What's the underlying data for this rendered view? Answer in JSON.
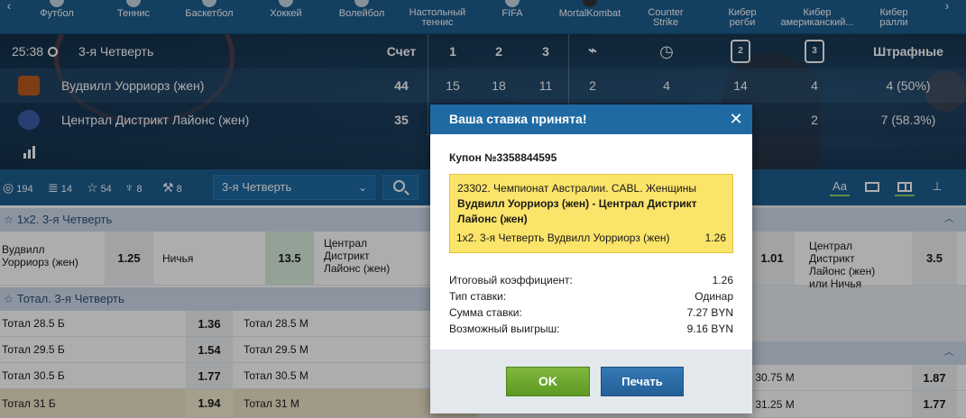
{
  "sports": [
    {
      "label": "Футбол",
      "icon": "football-icon"
    },
    {
      "label": "Теннис",
      "icon": "tennis-icon"
    },
    {
      "label": "Баскетбол",
      "icon": "basketball-icon"
    },
    {
      "label": "Хоккей",
      "icon": "hockey-icon"
    },
    {
      "label": "Волейбол",
      "icon": "volleyball-icon"
    },
    {
      "label": "Настольный",
      "label2": "теннис",
      "icon": "table-tennis-icon"
    },
    {
      "label": "FIFA",
      "icon": "fifa-icon"
    },
    {
      "label": "MortalKombat",
      "icon": "mortal-kombat-icon"
    },
    {
      "label": "Counter",
      "label2": "Strike",
      "icon": "counter-strike-icon"
    },
    {
      "label": "Кибер",
      "label2": "регби",
      "icon": "cyber-rugby-icon"
    },
    {
      "label": "Кибер",
      "label2": "американский...",
      "icon": "cyber-american-football-icon"
    },
    {
      "label": "Кибер",
      "label2": "ралли",
      "icon": "cyber-rally-icon"
    }
  ],
  "scoreboard": {
    "time": "25:38",
    "period": "3-я Четверть",
    "headers": {
      "score": "Счет",
      "q1": "1",
      "q2": "2",
      "q3": "3",
      "fouls": "Штрафные",
      "h2": "2",
      "h3": "3"
    },
    "teams": [
      {
        "name": "Вудвилл Уорриорз (жен)",
        "score": "44",
        "q1": "15",
        "q2": "18",
        "q3": "11",
        "whistle": "2",
        "timeouts": "4",
        "two": "14",
        "three": "4",
        "fouls": "4 (50%)"
      },
      {
        "name": "Централ Дистрикт Лайонс (жен)",
        "score": "35",
        "q1": "",
        "q2": "",
        "q3": "",
        "whistle": "",
        "timeouts": "",
        "two": "",
        "three": "2",
        "fouls": "7 (58.3%)"
      }
    ]
  },
  "filters": {
    "all": "194",
    "list": "14",
    "star": "54",
    "trophy": "8",
    "magic": "8",
    "period_select": "3-я Четверть"
  },
  "markets": {
    "m1": {
      "title": "1х2. 3-я Четверть",
      "team1": "Вудвилл Уорриорз (жен)",
      "k1": "1.25",
      "draw": "Ничья",
      "kx": "13.5",
      "team2": "Централ Дистрикт Лайонс (жен)",
      "right_k": "1.01",
      "right_label": "Централ Дистрикт Лайонс (жен) или Ничья",
      "right_k2": "3.5"
    },
    "m2": {
      "title": "Тотал. 3-я Четверть",
      "rows": [
        {
          "over": "Тотал 28.5 Б",
          "ko": "1.36",
          "under": "Тотал 28.5 М"
        },
        {
          "over": "Тотал 29.5 Б",
          "ko": "1.54",
          "under": "Тотал 29.5 М"
        },
        {
          "over": "Тотал 30.5 Б",
          "ko": "1.77",
          "under": "Тотал 30.5 М"
        },
        {
          "over": "Тотал 31 Б",
          "ko": "1.94",
          "under": "Тотал 31 М"
        }
      ],
      "right_rows": [
        {
          "label": "л 30.75 М",
          "k": "1.87"
        },
        {
          "label": "л 31.25 М",
          "k": "1.77"
        }
      ]
    }
  },
  "modal": {
    "title": "Ваша ставка принята!",
    "coupon": "Купон №3358844595",
    "event_line": "23302. Чемпионат Австралии. CABL. Женщины",
    "match": "Вудвилл Уорриорз (жен) - Централ Дистрикт Лайонс (жен)",
    "bet": "1х2. 3-я Четверть Вудвилл Уорриорз (жен)",
    "bet_k": "1.26",
    "summary": [
      {
        "label": "Итоговый коэффициент:",
        "value": "1.26"
      },
      {
        "label": "Тип ставки:",
        "value": "Одинар"
      },
      {
        "label": "Сумма ставки:",
        "value": "7.27 BYN"
      },
      {
        "label": "Возможный выигрыш:",
        "value": "9.16 BYN"
      }
    ],
    "ok": "OK",
    "print": "Печать"
  }
}
